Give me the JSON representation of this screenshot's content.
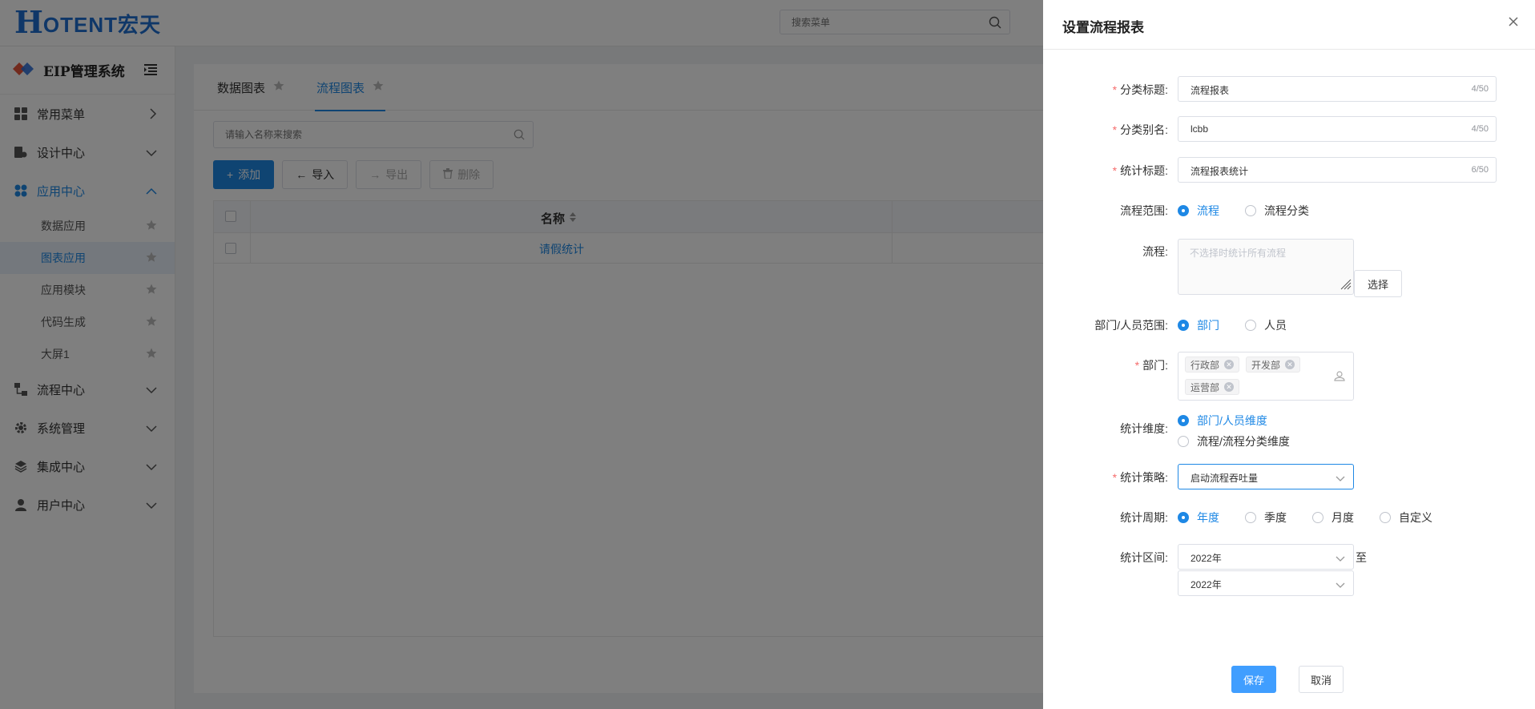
{
  "header": {
    "logo_letter": "H",
    "logo_text": "OTENT宏天",
    "search_placeholder": "搜索菜单"
  },
  "sidebar": {
    "brand": "EIP管理系统",
    "menu": [
      {
        "label": "常用菜单"
      },
      {
        "label": "设计中心"
      },
      {
        "label": "应用中心"
      },
      {
        "label": "流程中心"
      },
      {
        "label": "系统管理"
      },
      {
        "label": "集成中心"
      },
      {
        "label": "用户中心"
      }
    ],
    "submenu": [
      {
        "label": "数据应用"
      },
      {
        "label": "图表应用"
      },
      {
        "label": "应用模块"
      },
      {
        "label": "代码生成"
      },
      {
        "label": "大屏1"
      }
    ]
  },
  "main": {
    "tabs": [
      {
        "label": "数据图表"
      },
      {
        "label": "流程图表"
      }
    ],
    "search_placeholder": "请输入名称来搜索",
    "toolbar": {
      "add": "添加",
      "import": "导入",
      "export": "导出",
      "delete": "删除"
    },
    "table": {
      "column_name": "名称",
      "rows": [
        {
          "name": "请假统计"
        }
      ]
    }
  },
  "drawer": {
    "title": "设置流程报表",
    "fields": {
      "category_title": {
        "label": "分类标题:",
        "value": "流程报表",
        "count": "4/50"
      },
      "category_alias": {
        "label": "分类别名:",
        "value": "lcbb",
        "count": "4/50"
      },
      "stat_title": {
        "label": "统计标题:",
        "value": "流程报表统计",
        "count": "6/50"
      },
      "flow_scope": {
        "label": "流程范围:",
        "options": [
          "流程",
          "流程分类"
        ],
        "selected": "流程"
      },
      "flow": {
        "label": "流程:",
        "placeholder": "不选择时统计所有流程",
        "button": "选择"
      },
      "org_scope": {
        "label": "部门/人员范围:",
        "options": [
          "部门",
          "人员"
        ],
        "selected": "部门"
      },
      "dept": {
        "label": "部门:",
        "tags": [
          "行政部",
          "开发部",
          "运营部"
        ]
      },
      "dimension": {
        "label": "统计维度:",
        "options": [
          "部门/人员维度",
          "流程/流程分类维度"
        ],
        "selected": "部门/人员维度"
      },
      "strategy": {
        "label": "统计策略:",
        "value": "启动流程吞吐量"
      },
      "period": {
        "label": "统计周期:",
        "options": [
          "年度",
          "季度",
          "月度",
          "自定义"
        ],
        "selected": "年度"
      },
      "range": {
        "label": "统计区间:",
        "from": "2022年",
        "to_label": "至",
        "to": "2022年"
      }
    },
    "buttons": {
      "save": "保存",
      "cancel": "取消"
    }
  },
  "colors": {
    "primary": "#1e88e5",
    "required": "#f56c6c",
    "save_button": "#409eff"
  }
}
